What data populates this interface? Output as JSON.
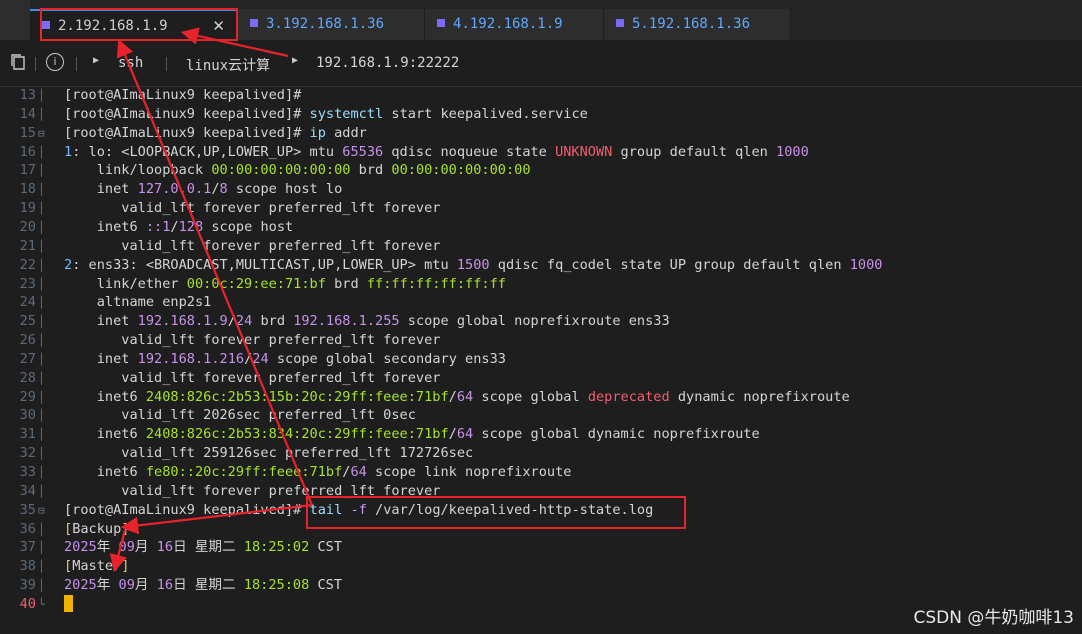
{
  "tabs": [
    {
      "label": "2.192.168.1.9",
      "active": true
    },
    {
      "label": "3.192.168.1.36",
      "active": false
    },
    {
      "label": "4.192.168.1.9",
      "active": false
    },
    {
      "label": "5.192.168.1.36",
      "active": false
    }
  ],
  "breadcrumb": {
    "items": [
      "ssh",
      "linux云计算",
      "192.168.1.9:22222"
    ]
  },
  "terminal": {
    "lines": [
      {
        "n": "13",
        "h": "[root@AImaLinux9 keepalived]#"
      },
      {
        "n": "14",
        "h": "[root@AImaLinux9 keepalived]# <span class='cm'>systemctl</span> start keepalived.service"
      },
      {
        "n": "15",
        "h": "[root@AImaLinux9 keepalived]# <span class='cm'>ip</span> addr",
        "fold": true
      },
      {
        "n": "16",
        "h": "<span class='b'>1</span>: lo: &lt;LOOPBACK,UP,LOWER_UP&gt; mtu <span class='p'>65536</span> qdisc noqueue state <span class='r'>UNKNOWN</span> group default qlen <span class='p'>1000</span>"
      },
      {
        "n": "17",
        "h": "    link/loopback <span class='g'>00:00:00:00:00:00</span> brd <span class='g'>00:00:00:00:00:00</span>"
      },
      {
        "n": "18",
        "h": "    inet <span class='p'>127.0.0.1</span>/<span class='p'>8</span> scope host lo"
      },
      {
        "n": "19",
        "h": "       valid_lft forever preferred_lft forever"
      },
      {
        "n": "20",
        "h": "    inet6 <span class='p'>::1</span>/<span class='p'>128</span> scope host"
      },
      {
        "n": "21",
        "h": "       valid_lft forever preferred_lft forever"
      },
      {
        "n": "22",
        "h": "<span class='b'>2</span>: ens33: &lt;BROADCAST,MULTICAST,UP,LOWER_UP&gt; mtu <span class='p'>1500</span> qdisc fq_codel state UP group default qlen <span class='p'>1000</span>"
      },
      {
        "n": "23",
        "h": "    link/ether <span class='g'>00:0c:29:ee:71:bf</span> brd <span class='g'>ff:ff:ff:ff:ff:ff</span>"
      },
      {
        "n": "24",
        "h": "    altname enp2s1"
      },
      {
        "n": "25",
        "h": "    inet <span class='p'>192.168.1.9</span>/<span class='p'>24</span> brd <span class='p'>192.168.1.255</span> scope global noprefixroute ens33"
      },
      {
        "n": "26",
        "h": "       valid_lft forever preferred_lft forever"
      },
      {
        "n": "27",
        "h": "    inet <span class='p'>192.168.1.216</span>/<span class='p'>24</span> scope global secondary ens33"
      },
      {
        "n": "28",
        "h": "       valid_lft forever preferred_lft forever"
      },
      {
        "n": "29",
        "h": "    inet6 <span class='g'>2408:826c:2b53:15b:20c:29ff:feee:71bf</span>/<span class='p'>64</span> scope global <span class='r'>deprecated</span> dynamic noprefixroute"
      },
      {
        "n": "30",
        "h": "       valid_lft 2026sec preferred_lft 0sec"
      },
      {
        "n": "31",
        "h": "    inet6 <span class='g'>2408:826c:2b53:834:20c:29ff:feee:71bf</span>/<span class='p'>64</span> scope global dynamic noprefixroute"
      },
      {
        "n": "32",
        "h": "       valid_lft 259126sec preferred_lft 172726sec"
      },
      {
        "n": "33",
        "h": "    inet6 <span class='g'>fe80::20c:29ff:feee:71bf</span>/<span class='p'>64</span> scope link noprefixroute"
      },
      {
        "n": "34",
        "h": "       valid_lft forever preferred_lft forever"
      },
      {
        "n": "35",
        "h": "[root@AImaLinux9 keepalived]# <span class='cm'>tail</span> <span class='p'>-f</span> /var/log/keepalived-http-state.log",
        "fold": true
      },
      {
        "n": "36",
        "h": "<span class='y'>[</span>Backup<span class='y'>]</span>"
      },
      {
        "n": "37",
        "h": "<span class='p'>2025</span>年 <span class='p'>09</span>月 <span class='p'>16</span>日 星期二 <span class='g'>18:25:02</span> CST"
      },
      {
        "n": "38",
        "h": "<span class='y'>[</span>Master<span class='y'>]</span>"
      },
      {
        "n": "39",
        "h": "<span class='p'>2025</span>年 <span class='p'>09</span>月 <span class='p'>16</span>日 星期二 <span class='g'>18:25:08</span> CST"
      },
      {
        "n": "40",
        "h": "<span class='cursor'></span>",
        "cur": true
      }
    ]
  },
  "watermark": "CSDN @牛奶咖啡13",
  "colors": {
    "accent": "#3b8eea",
    "annotation": "#e8232b"
  }
}
